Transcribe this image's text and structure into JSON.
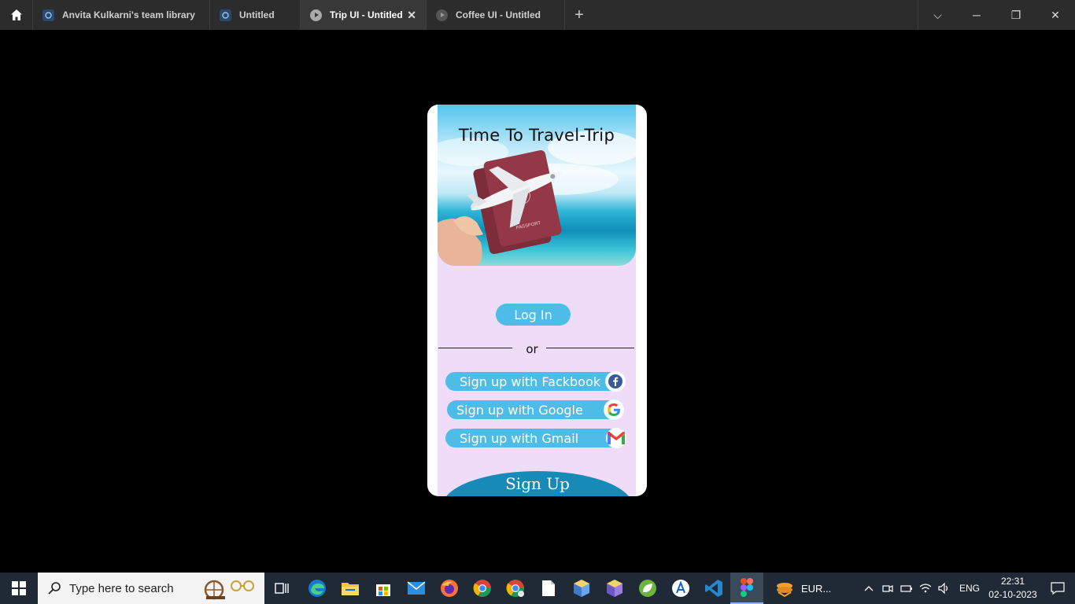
{
  "tabs": [
    {
      "label": "Anvita Kulkarni's team library",
      "icon": "figma-file-icon",
      "active": false
    },
    {
      "label": "Untitled",
      "icon": "figma-file-icon",
      "active": false
    },
    {
      "label": "Trip UI - Untitled",
      "icon": "play-icon",
      "active": true
    },
    {
      "label": "Coffee UI - Untitled",
      "icon": "play-icon",
      "active": false
    }
  ],
  "window_controls": {
    "dropdown": "⌵",
    "minimize": "─",
    "restore": "❐",
    "close": "✕"
  },
  "app": {
    "title": "Time To Travel-Trip",
    "login_label": "Log In",
    "or_label": "or",
    "facebook_label": "Sign up with Fackbook",
    "google_label": "Sign up with Google",
    "gmail_label": "Sign up with Gmail",
    "signup_label": "Sign Up",
    "accent": "#4dbde7",
    "background": "#efdcf8",
    "signup_color": "#178ab8"
  },
  "taskbar": {
    "search_placeholder": "Type here to search",
    "weather_label": "EUR...",
    "language": "ENG",
    "time": "22:31",
    "date": "02-10-2023"
  }
}
